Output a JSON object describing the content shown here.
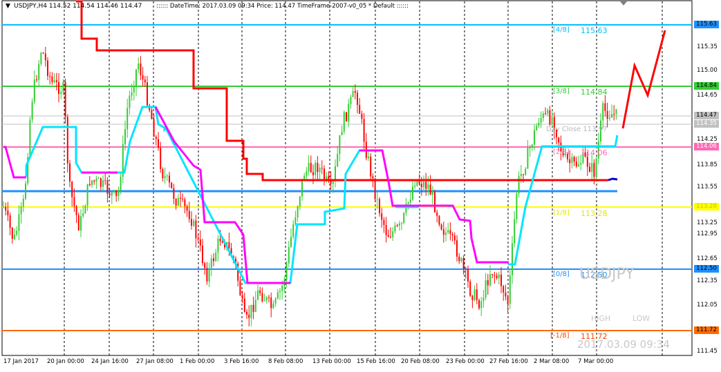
{
  "header": {
    "collapse_glyph": "▼",
    "symbol_info": "USDJPY,H4  114.52 114.54 114.46 114.47",
    "indicator_info": ":::::: DateTime: 2017.03.09 09:34    Price: 114.47    TimeFrame-2007-v0_05    *  Default  ::::::"
  },
  "price_axis": {
    "ticks": [
      "115.35",
      "115.00",
      "114.65",
      "114.25",
      "113.85",
      "113.55",
      "113.25",
      "112.95",
      "112.65",
      "112.35",
      "112.05",
      "111.45"
    ]
  },
  "price_labels": [
    {
      "text": "115.63",
      "color": "#1e90ff"
    },
    {
      "text": "114.84",
      "color": "#32cd32"
    },
    {
      "text": "114.47",
      "color": "#c0c0c0"
    },
    {
      "text": "114.35",
      "color": "#c0c0c0"
    },
    {
      "text": "114.06",
      "color": "#ff69b4"
    },
    {
      "text": "113.28",
      "color": "#ffff00"
    },
    {
      "text": "112.50",
      "color": "#1e90ff"
    },
    {
      "text": "111.72",
      "color": "#ff6a00"
    }
  ],
  "time_axis": [
    "17 Jan 2017",
    "20 Jan 00:00",
    "24 Jan 16:00",
    "27 Jan 08:00",
    "1 Feb 00:00",
    "3 Feb 16:00",
    "8 Feb 08:00",
    "13 Feb 00:00",
    "15 Feb 16:00",
    "20 Feb 08:00",
    "23 Feb 00:00",
    "27 Feb 16:00",
    "2 Mar 08:00",
    "7 Mar 00:00"
  ],
  "murrey_levels": [
    {
      "tag": "[4/8]",
      "value": "115.63",
      "color": "#00bfff"
    },
    {
      "tag": "[3/8]",
      "value": "114.84",
      "color": "#32cd32"
    },
    {
      "tag": "[2/8]",
      "value": "114.06",
      "color": "#ff69b4"
    },
    {
      "tag": "[1/8]",
      "value": "113.28",
      "color": "#e6e600"
    },
    {
      "tag": "[0/8]",
      "value": "112.50",
      "color": "#1e90ff"
    },
    {
      "tag": "[-1/8]",
      "value": "111.72",
      "color": "#ff4500"
    }
  ],
  "overlay": {
    "day_close_label": "Day Close 113.97",
    "watermark_symbol": "USDJPY",
    "high_label": "HIGH",
    "low_label": "LOW",
    "watermark_time": "2017.03.09 09:34"
  },
  "colors": {
    "bull_candle": "#32cd32",
    "bear_candle": "#ff0000",
    "trail_red": "#ff0000",
    "trail_cyan": "#00e5ff",
    "trail_magenta": "#ff00ff"
  }
}
